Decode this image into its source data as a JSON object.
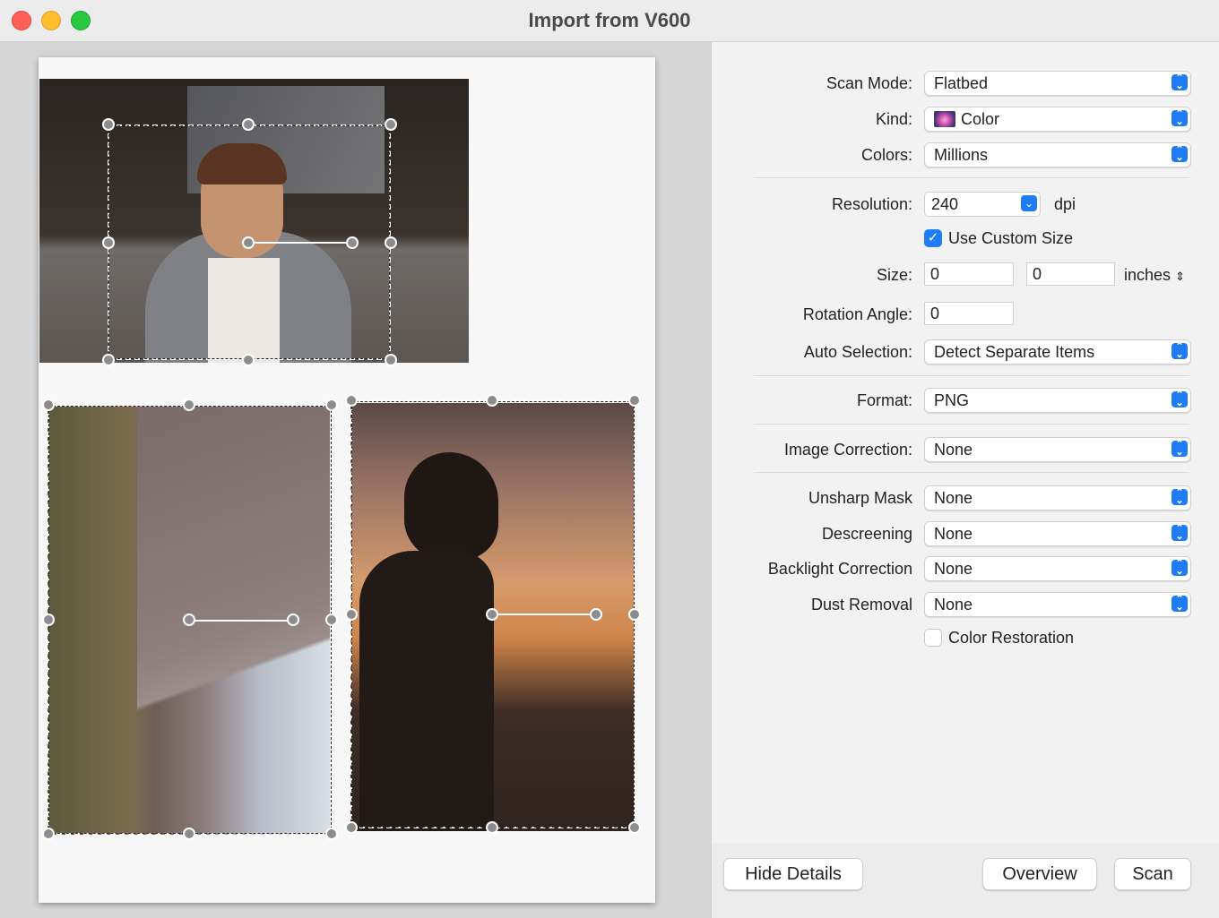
{
  "window": {
    "title": "Import from V600"
  },
  "settings": {
    "scan_mode": {
      "label": "Scan Mode:",
      "value": "Flatbed"
    },
    "kind": {
      "label": "Kind:",
      "value": "Color",
      "icon": "color-flower-icon"
    },
    "colors": {
      "label": "Colors:",
      "value": "Millions"
    },
    "resolution": {
      "label": "Resolution:",
      "value": "240",
      "unit": "dpi"
    },
    "use_custom_size": {
      "label": "Use Custom Size",
      "checked": true
    },
    "size": {
      "label": "Size:",
      "width": "0",
      "height": "0",
      "unit": "inches"
    },
    "rotation_angle": {
      "label": "Rotation Angle:",
      "value": "0"
    },
    "auto_selection": {
      "label": "Auto Selection:",
      "value": "Detect Separate Items"
    },
    "format": {
      "label": "Format:",
      "value": "PNG"
    },
    "image_correction": {
      "label": "Image Correction:",
      "value": "None"
    },
    "unsharp_mask": {
      "label": "Unsharp Mask",
      "value": "None"
    },
    "descreening": {
      "label": "Descreening",
      "value": "None"
    },
    "backlight_correction": {
      "label": "Backlight Correction",
      "value": "None"
    },
    "dust_removal": {
      "label": "Dust Removal",
      "value": "None"
    },
    "color_restoration": {
      "label": "Color Restoration",
      "checked": false
    }
  },
  "buttons": {
    "hide_details": "Hide Details",
    "overview": "Overview",
    "scan": "Scan"
  },
  "colors": {
    "accent": "#1f7cf5",
    "close": "#fe5f57",
    "minimize": "#febc2e",
    "maximize": "#28c840"
  }
}
